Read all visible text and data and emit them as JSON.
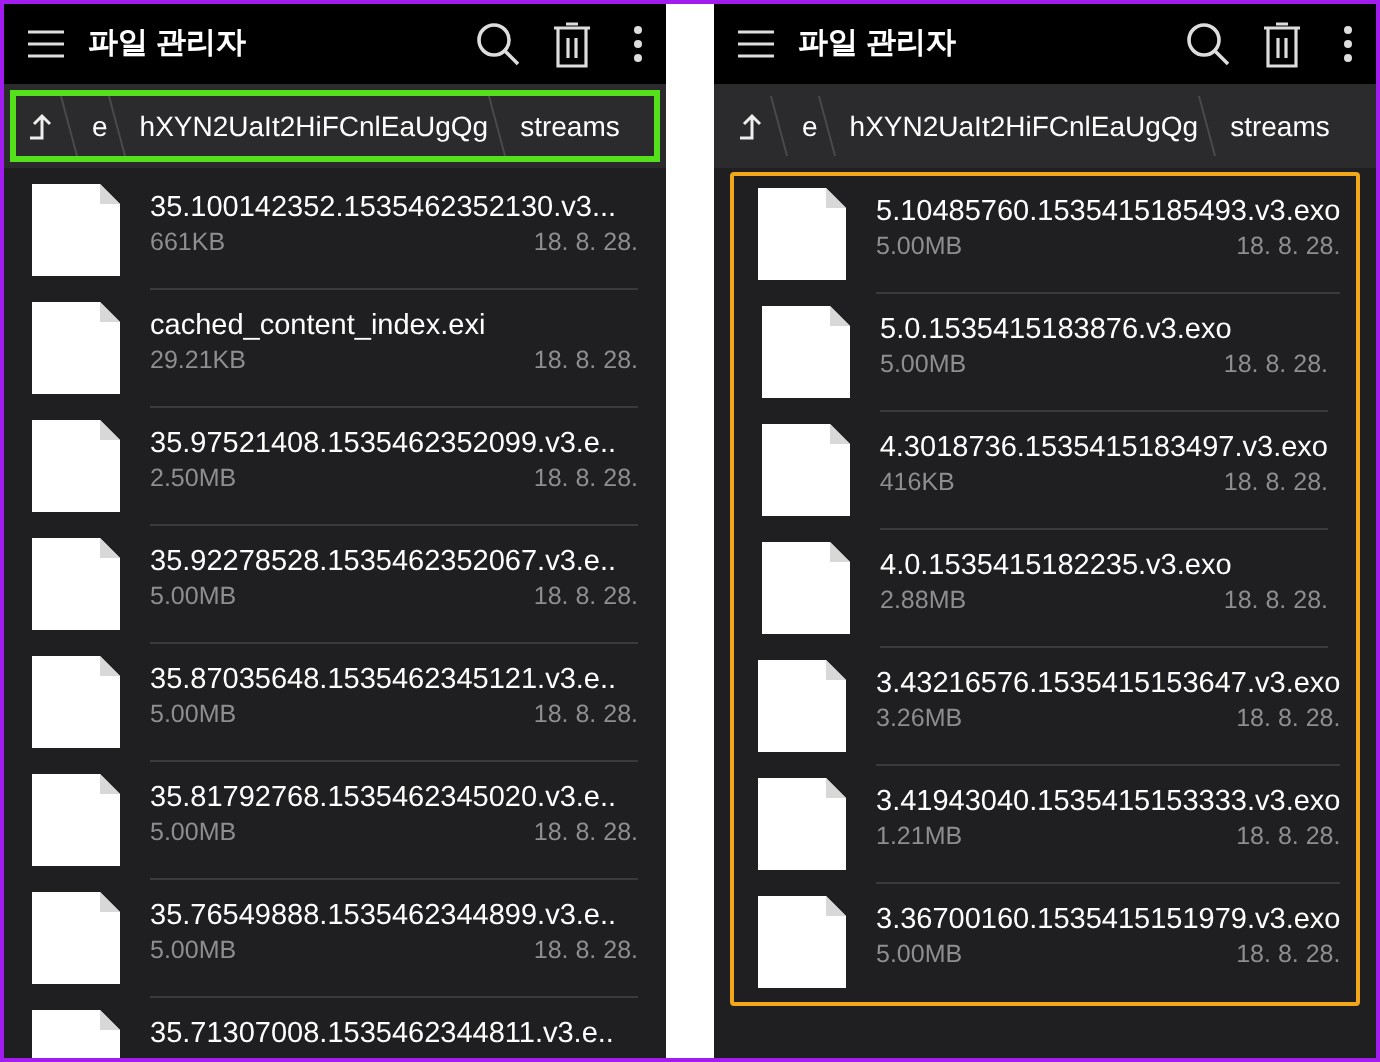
{
  "panels": [
    {
      "title": "파일 관리자",
      "breadcrumb": {
        "highlighted": true,
        "segments": [
          "e",
          "hXYN2UaIt2HiFCnlEaUgQg",
          "streams"
        ]
      },
      "list_highlighted": false,
      "files": [
        {
          "name": "35.100142352.1535462352130.v3...",
          "size": "661KB",
          "date": "18. 8. 28."
        },
        {
          "name": "cached_content_index.exi",
          "size": "29.21KB",
          "date": "18. 8. 28."
        },
        {
          "name": "35.97521408.1535462352099.v3.e..",
          "size": "2.50MB",
          "date": "18. 8. 28."
        },
        {
          "name": "35.92278528.1535462352067.v3.e..",
          "size": "5.00MB",
          "date": "18. 8. 28."
        },
        {
          "name": "35.87035648.1535462345121.v3.e..",
          "size": "5.00MB",
          "date": "18. 8. 28."
        },
        {
          "name": "35.81792768.1535462345020.v3.e..",
          "size": "5.00MB",
          "date": "18. 8. 28."
        },
        {
          "name": "35.76549888.1535462344899.v3.e..",
          "size": "5.00MB",
          "date": "18. 8. 28."
        },
        {
          "name": "35.71307008.1535462344811.v3.e.."
        }
      ]
    },
    {
      "title": "파일 관리자",
      "breadcrumb": {
        "highlighted": false,
        "segments": [
          "e",
          "hXYN2UaIt2HiFCnlEaUgQg",
          "streams"
        ]
      },
      "list_highlighted": true,
      "files": [
        {
          "name": "5.10485760.1535415185493.v3.exo",
          "size": "5.00MB",
          "date": "18. 8. 28."
        },
        {
          "name": "5.0.1535415183876.v3.exo",
          "size": "5.00MB",
          "date": "18. 8. 28."
        },
        {
          "name": "4.3018736.1535415183497.v3.exo",
          "size": "416KB",
          "date": "18. 8. 28."
        },
        {
          "name": "4.0.1535415182235.v3.exo",
          "size": "2.88MB",
          "date": "18. 8. 28."
        },
        {
          "name": "3.43216576.1535415153647.v3.exo",
          "size": "3.26MB",
          "date": "18. 8. 28."
        },
        {
          "name": "3.41943040.1535415153333.v3.exo",
          "size": "1.21MB",
          "date": "18. 8. 28."
        },
        {
          "name": "3.36700160.1535415151979.v3.exo",
          "size": "5.00MB",
          "date": "18. 8. 28."
        }
      ]
    }
  ]
}
